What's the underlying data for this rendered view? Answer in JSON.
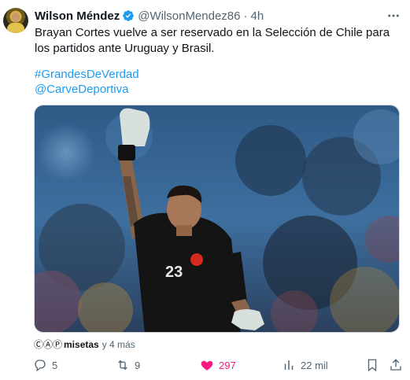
{
  "author": {
    "name": "Wilson Méndez",
    "handle": "@WilsonMendez86",
    "separator": "·",
    "time": "4h",
    "verified": true
  },
  "tweet": {
    "text": "Brayan Cortes vuelve a ser reservado en la Selección de Chile para los partidos ante Uruguay y Brasil.",
    "hashtags": [
      "#GrandesDeVerdad",
      "@CarveDeportiva"
    ]
  },
  "media": {
    "jersey_number": "23"
  },
  "attribution": {
    "license_symbols": "ⒸⒶⓅ",
    "user": "misetas",
    "age": "y 4 más"
  },
  "actions": {
    "replies": "5",
    "retweets": "9",
    "likes": "297",
    "views": "22 mil"
  },
  "colors": {
    "link": "#1d9bf0",
    "like": "#f91880",
    "muted": "#536471",
    "verified": "#1d9bf0"
  }
}
